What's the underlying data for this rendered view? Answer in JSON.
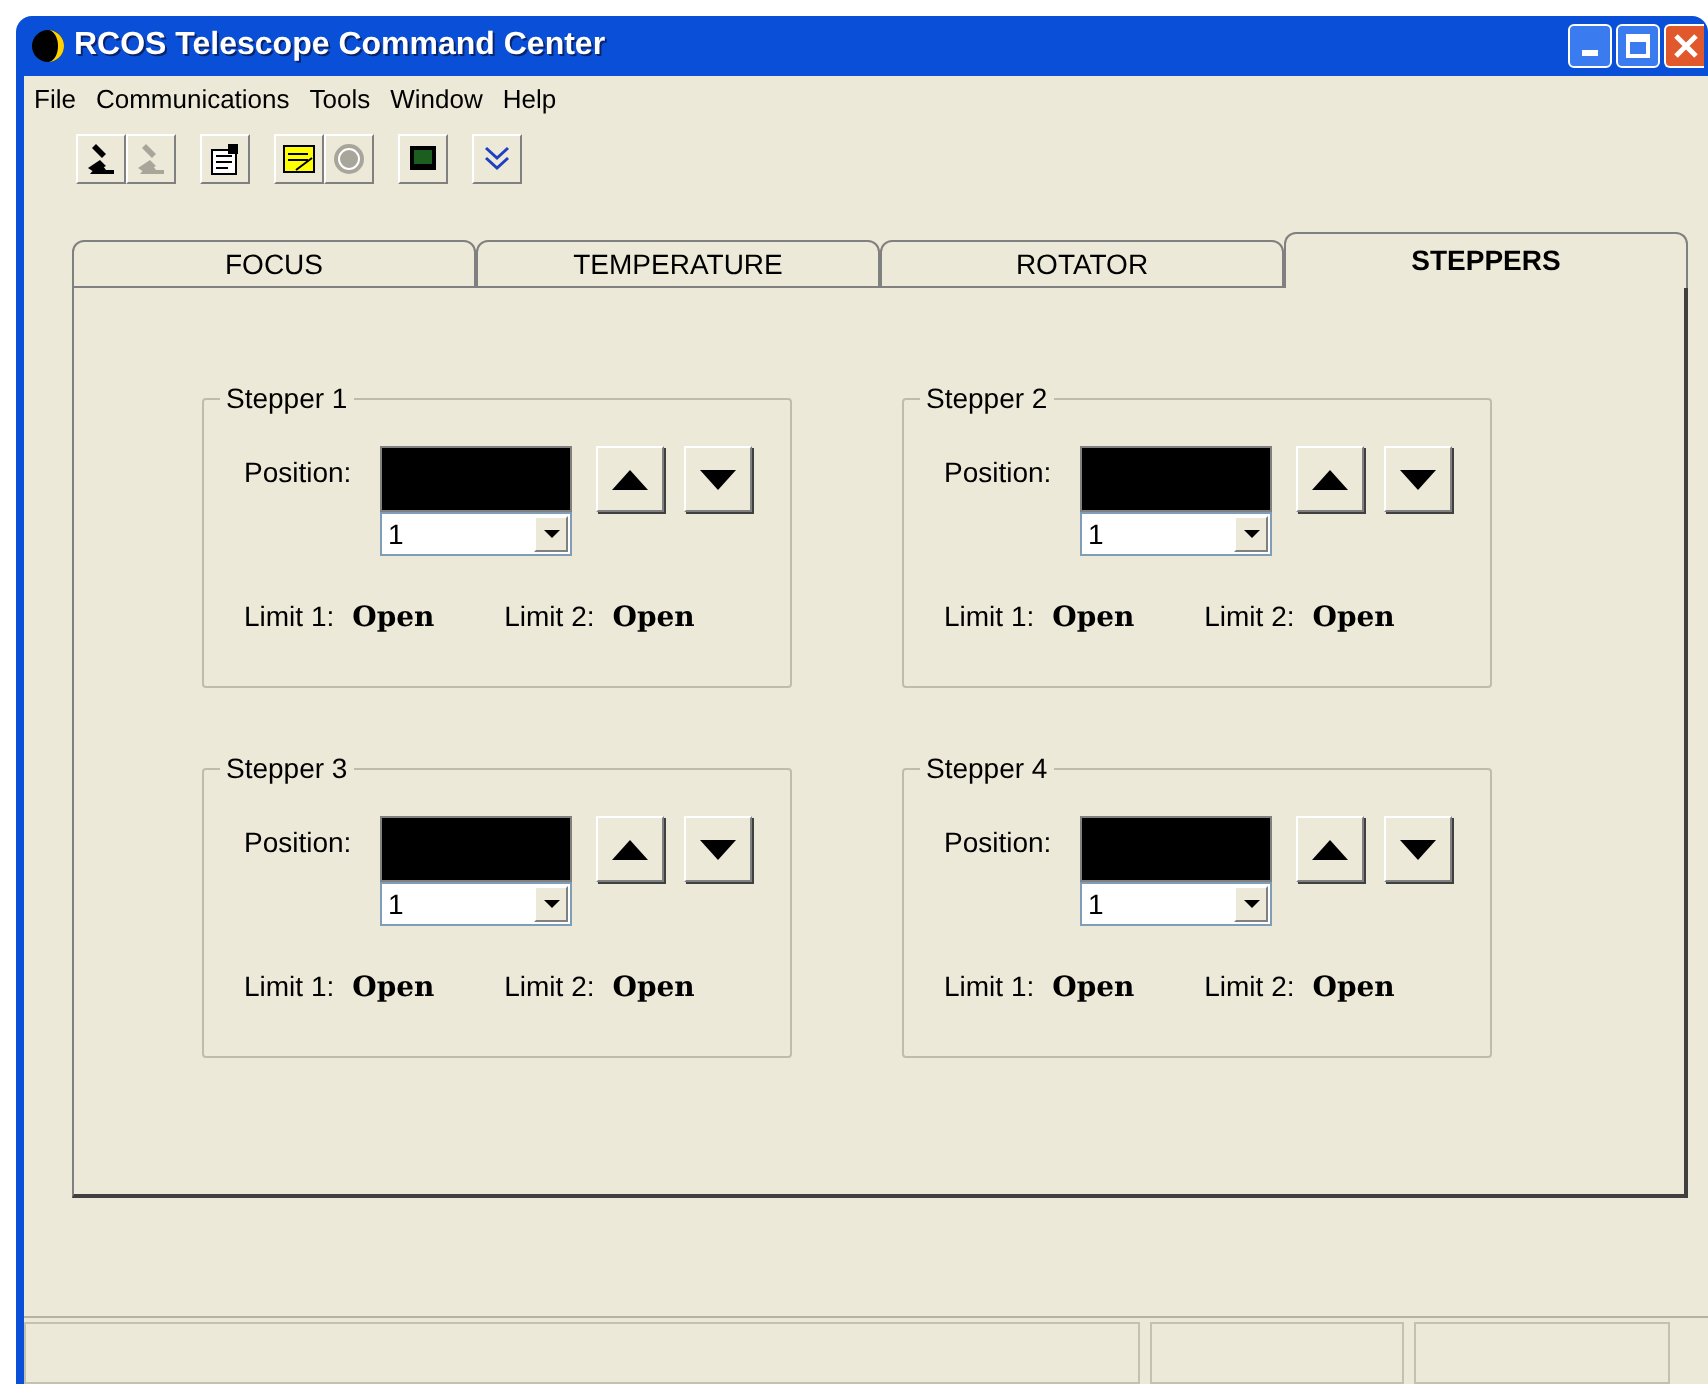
{
  "window": {
    "title": "RCOS Telescope Command Center"
  },
  "menu": [
    "File",
    "Communications",
    "Tools",
    "Window",
    "Help"
  ],
  "toolbar": [
    {
      "disabled": false
    },
    {
      "disabled": true
    },
    {
      "disabled": false
    },
    {
      "disabled": false
    },
    {
      "disabled": true
    },
    {
      "disabled": false
    },
    {
      "disabled": false
    }
  ],
  "tabs": [
    {
      "label": "FOCUS",
      "selected": false
    },
    {
      "label": "TEMPERATURE",
      "selected": false
    },
    {
      "label": "ROTATOR",
      "selected": false
    },
    {
      "label": "STEPPERS",
      "selected": true
    }
  ],
  "steppers": [
    {
      "title": "Stepper 1",
      "position_label": "Position:",
      "step": "1",
      "limit_1_label": "Limit 1:",
      "limit_1": "Open",
      "limit_2_label": "Limit 2:",
      "limit_2": "Open"
    },
    {
      "title": "Stepper 2",
      "position_label": "Position:",
      "step": "1",
      "limit_1_label": "Limit 1:",
      "limit_1": "Open",
      "limit_2_label": "Limit 2:",
      "limit_2": "Open"
    },
    {
      "title": "Stepper 3",
      "position_label": "Position:",
      "step": "1",
      "limit_1_label": "Limit 1:",
      "limit_1": "Open",
      "limit_2_label": "Limit 2:",
      "limit_2": "Open"
    },
    {
      "title": "Stepper 4",
      "position_label": "Position:",
      "step": "1",
      "limit_1_label": "Limit 1:",
      "limit_1": "Open",
      "limit_2_label": "Limit 2:",
      "limit_2": "Open"
    }
  ]
}
